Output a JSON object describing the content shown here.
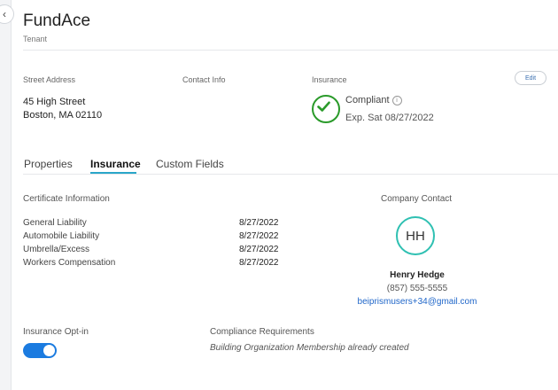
{
  "nav": {
    "back_icon": "chevron-left-icon"
  },
  "header": {
    "title": "FundAce",
    "subtitle": "Tenant"
  },
  "summary": {
    "street_address_label": "Street Address",
    "address_line1": "45 High Street",
    "address_line2": "Boston, MA 02110",
    "contact_info_label": "Contact Info",
    "insurance_label": "Insurance",
    "edit_label": "Edit",
    "status_text": "Compliant",
    "status_icon": "check-circle-icon",
    "status_color": "#2a9a2a",
    "expiry_text": "Exp. Sat 08/27/2022"
  },
  "tabs": [
    {
      "label": "Properties",
      "active": false
    },
    {
      "label": "Insurance",
      "active": true
    },
    {
      "label": "Custom Fields",
      "active": false
    }
  ],
  "certificate": {
    "heading": "Certificate Information",
    "rows": [
      {
        "name": "General Liability",
        "date": "8/27/2022"
      },
      {
        "name": "Automobile Liability",
        "date": "8/27/2022"
      },
      {
        "name": "Umbrella/Excess",
        "date": "8/27/2022"
      },
      {
        "name": "Workers Compensation",
        "date": "8/27/2022"
      }
    ]
  },
  "company_contact": {
    "heading": "Company Contact",
    "initials": "HH",
    "name": "Henry Hedge",
    "phone": "(857) 555-5555",
    "email": "beiprismusers+34@gmail.com"
  },
  "opt_in": {
    "label": "Insurance Opt-in",
    "enabled": true,
    "toggle_color": "#1b7be0"
  },
  "compliance": {
    "heading": "Compliance Requirements",
    "text": "Building Organization Membership already created"
  },
  "accent_color": "#2aa6c9"
}
